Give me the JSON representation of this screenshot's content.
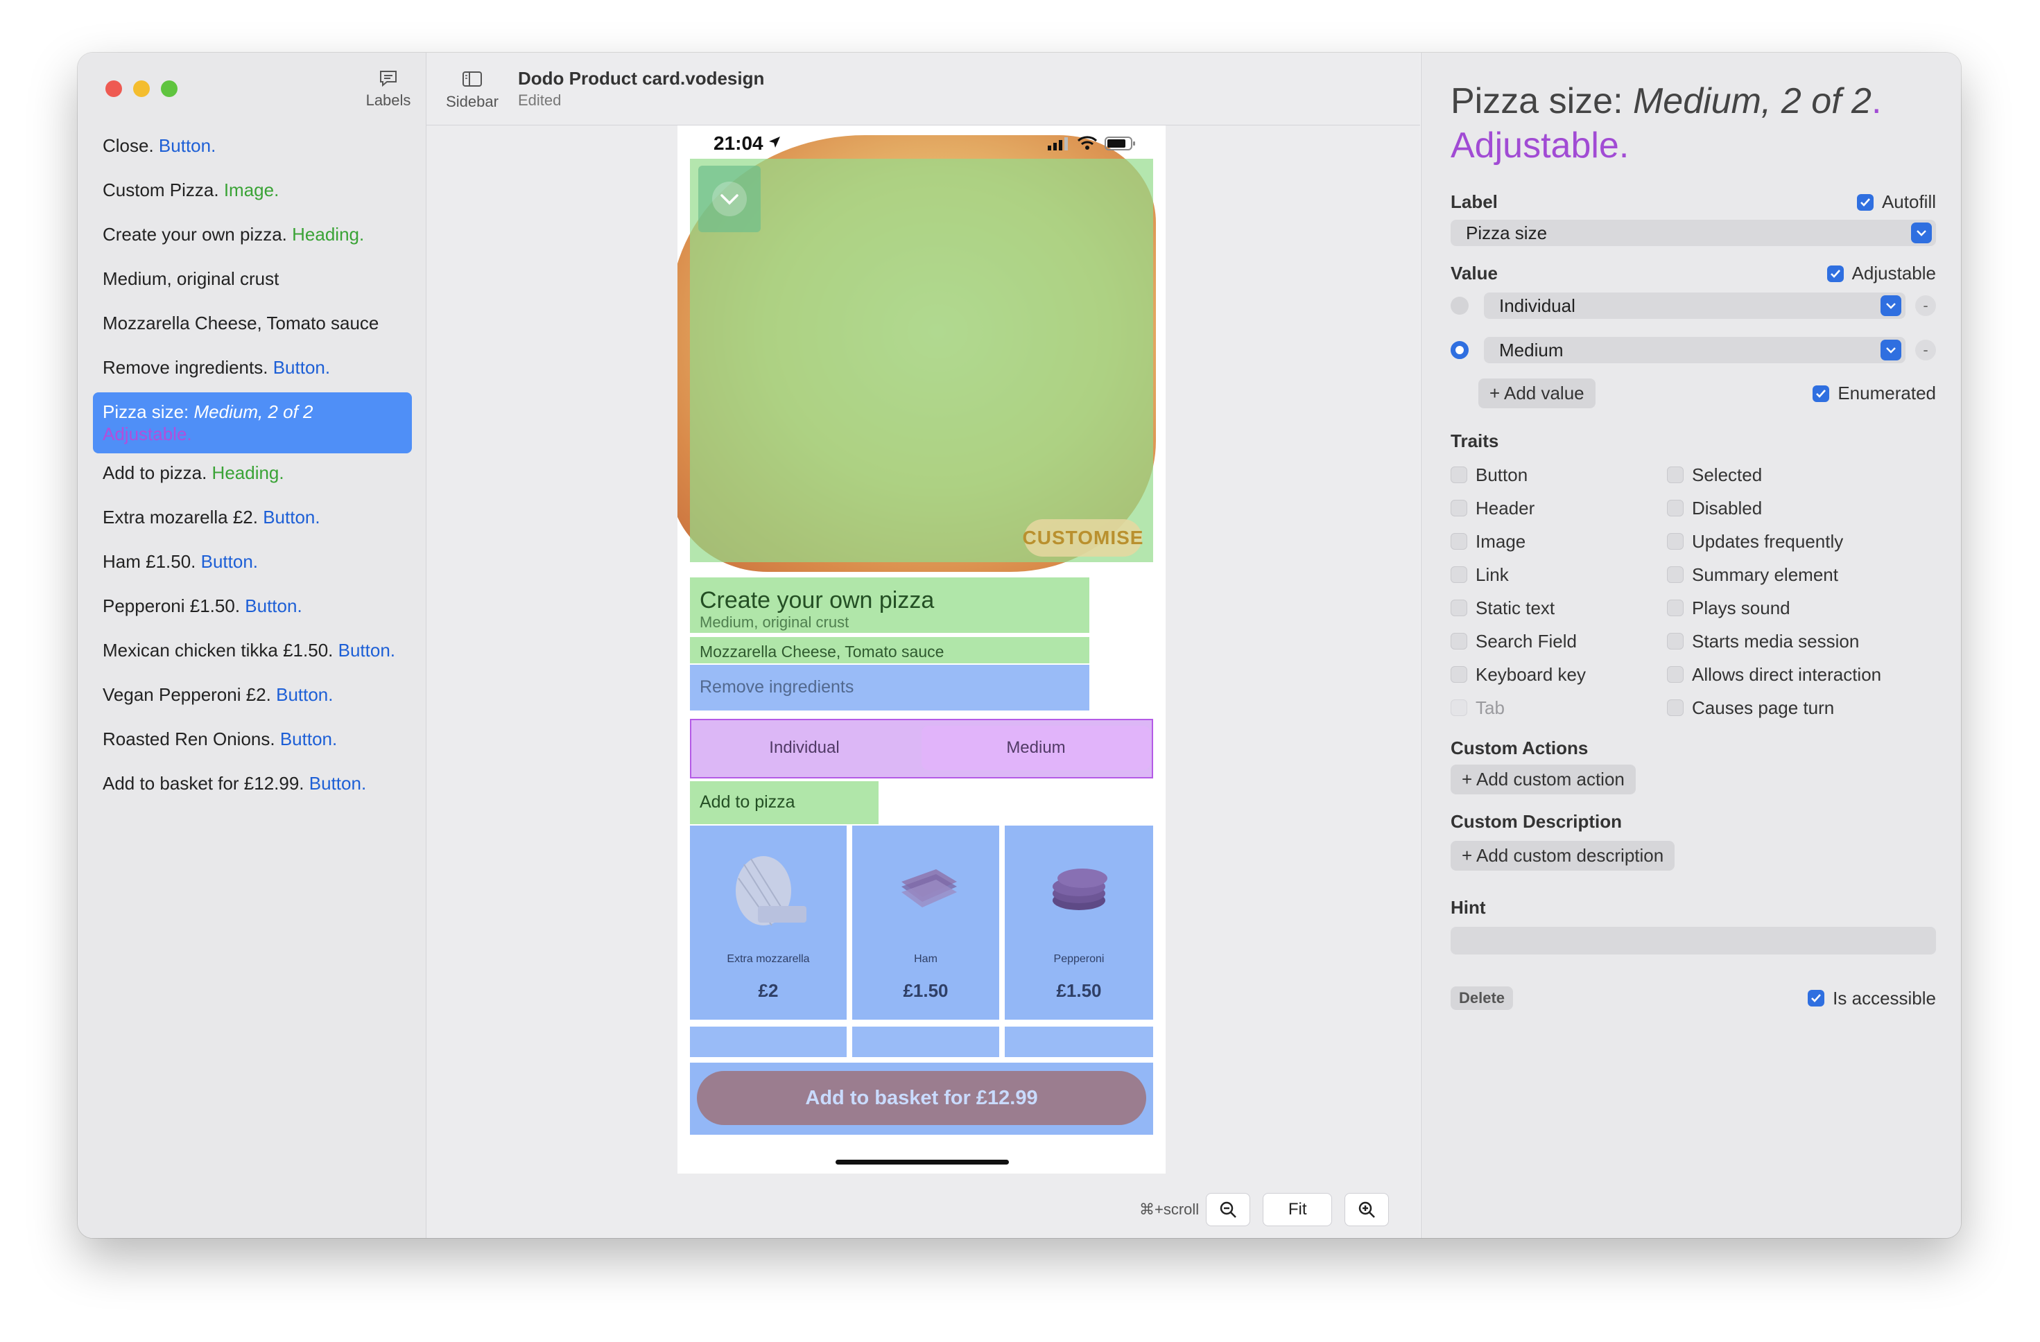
{
  "window": {
    "labels_toolbar": "Labels",
    "sidebar_toolbar": "Sidebar",
    "doc_title": "Dodo Product card.vodesign",
    "doc_status": "Edited"
  },
  "element_list": [
    {
      "text": "Close.",
      "trait": " Button.",
      "trait_kind": "btn"
    },
    {
      "text": "Custom Pizza.",
      "trait": " Image.",
      "trait_kind": "img"
    },
    {
      "text": "Create your own pizza.",
      "trait": " Heading.",
      "trait_kind": "head"
    },
    {
      "text": "Medium, original crust",
      "trait": "",
      "trait_kind": ""
    },
    {
      "text": "Mozzarella Cheese, Tomato sauce",
      "trait": "",
      "trait_kind": ""
    },
    {
      "text": "Remove ingredients.",
      "trait": " Button.",
      "trait_kind": "btn"
    },
    {
      "text": "Pizza size: ",
      "value": "Medium, 2 of 2",
      "trait": "Adjustable.",
      "trait_kind": "adj",
      "selected": true
    },
    {
      "text": "Add to pizza.",
      "trait": " Heading.",
      "trait_kind": "head"
    },
    {
      "text": "Extra mozarella £2.",
      "trait": " Button.",
      "trait_kind": "btn"
    },
    {
      "text": "Ham £1.50.",
      "trait": " Button.",
      "trait_kind": "btn"
    },
    {
      "text": "Pepperoni £1.50.",
      "trait": " Button.",
      "trait_kind": "btn"
    },
    {
      "text": "Mexican chicken tikka £1.50.",
      "trait": " Button.",
      "trait_kind": "btn"
    },
    {
      "text": "Vegan Pepperoni £2.",
      "trait": " Button.",
      "trait_kind": "btn"
    },
    {
      "text": "Roasted Ren Onions.",
      "trait": " Button.",
      "trait_kind": "btn"
    },
    {
      "text": "Add to basket for £12.99.",
      "trait": " Button.",
      "trait_kind": "btn"
    }
  ],
  "phone": {
    "time": "21:04",
    "customise": "CUSTOMISE",
    "heading": "Create your own pizza",
    "subheading": "Medium, original crust",
    "ingredients": "Mozzarella Cheese, Tomato sauce",
    "remove": "Remove ingredients",
    "size_options": [
      "Individual",
      "Medium"
    ],
    "size_selected": "Medium",
    "add_heading": "Add to pizza",
    "toppings": [
      {
        "name": "Extra mozzarella",
        "price": "£2"
      },
      {
        "name": "Ham",
        "price": "£1.50"
      },
      {
        "name": "Pepperoni",
        "price": "£1.50"
      }
    ],
    "basket": "Add to basket for £12.99"
  },
  "zoom": {
    "hint": "⌘+scroll",
    "fit": "Fit"
  },
  "inspector": {
    "title_prefix": "Pizza size: ",
    "title_value": "Medium, 2 of 2",
    "title_dot": ".",
    "title_trait": "Adjustable.",
    "label_section": "Label",
    "autofill_label": "Autofill",
    "autofill_checked": true,
    "label_value": "Pizza size",
    "value_section": "Value",
    "adjustable_label": "Adjustable",
    "adjustable_checked": true,
    "values": [
      {
        "text": "Individual",
        "selected": false
      },
      {
        "text": "Medium",
        "selected": true
      }
    ],
    "add_value": "+ Add value",
    "enumerated_label": "Enumerated",
    "enumerated_checked": true,
    "traits_section": "Traits",
    "traits_left": [
      {
        "label": "Button",
        "checked": false,
        "disabled": false
      },
      {
        "label": "Header",
        "checked": false,
        "disabled": false
      },
      {
        "label": "Image",
        "checked": false,
        "disabled": false
      },
      {
        "label": "Link",
        "checked": false,
        "disabled": false
      },
      {
        "label": "Static text",
        "checked": false,
        "disabled": false
      },
      {
        "label": "Search Field",
        "checked": false,
        "disabled": false
      },
      {
        "label": "Keyboard key",
        "checked": false,
        "disabled": false
      },
      {
        "label": "Tab",
        "checked": false,
        "disabled": true
      }
    ],
    "traits_right": [
      {
        "label": "Selected",
        "checked": false,
        "disabled": false
      },
      {
        "label": "Disabled",
        "checked": false,
        "disabled": false
      },
      {
        "label": "Updates frequently",
        "checked": false,
        "disabled": false
      },
      {
        "label": "Summary element",
        "checked": false,
        "disabled": false
      },
      {
        "label": "Plays sound",
        "checked": false,
        "disabled": false
      },
      {
        "label": "Starts media session",
        "checked": false,
        "disabled": false
      },
      {
        "label": "Allows direct interaction",
        "checked": false,
        "disabled": false
      },
      {
        "label": "Causes page turn",
        "checked": false,
        "disabled": false
      }
    ],
    "custom_actions_section": "Custom Actions",
    "add_custom_action": "+ Add custom action",
    "custom_description_section": "Custom Description",
    "add_custom_description": "+ Add custom description",
    "hint_section": "Hint",
    "hint_value": "",
    "delete_label": "Delete",
    "is_accessible_label": "Is accessible",
    "is_accessible_checked": true
  },
  "colors": {
    "accent": "#2f6fe0",
    "selection": "#4f8ff7",
    "trait_button": "#1d5fd6",
    "trait_heading": "#3aa336",
    "trait_adjustable": "#b04fdc"
  }
}
